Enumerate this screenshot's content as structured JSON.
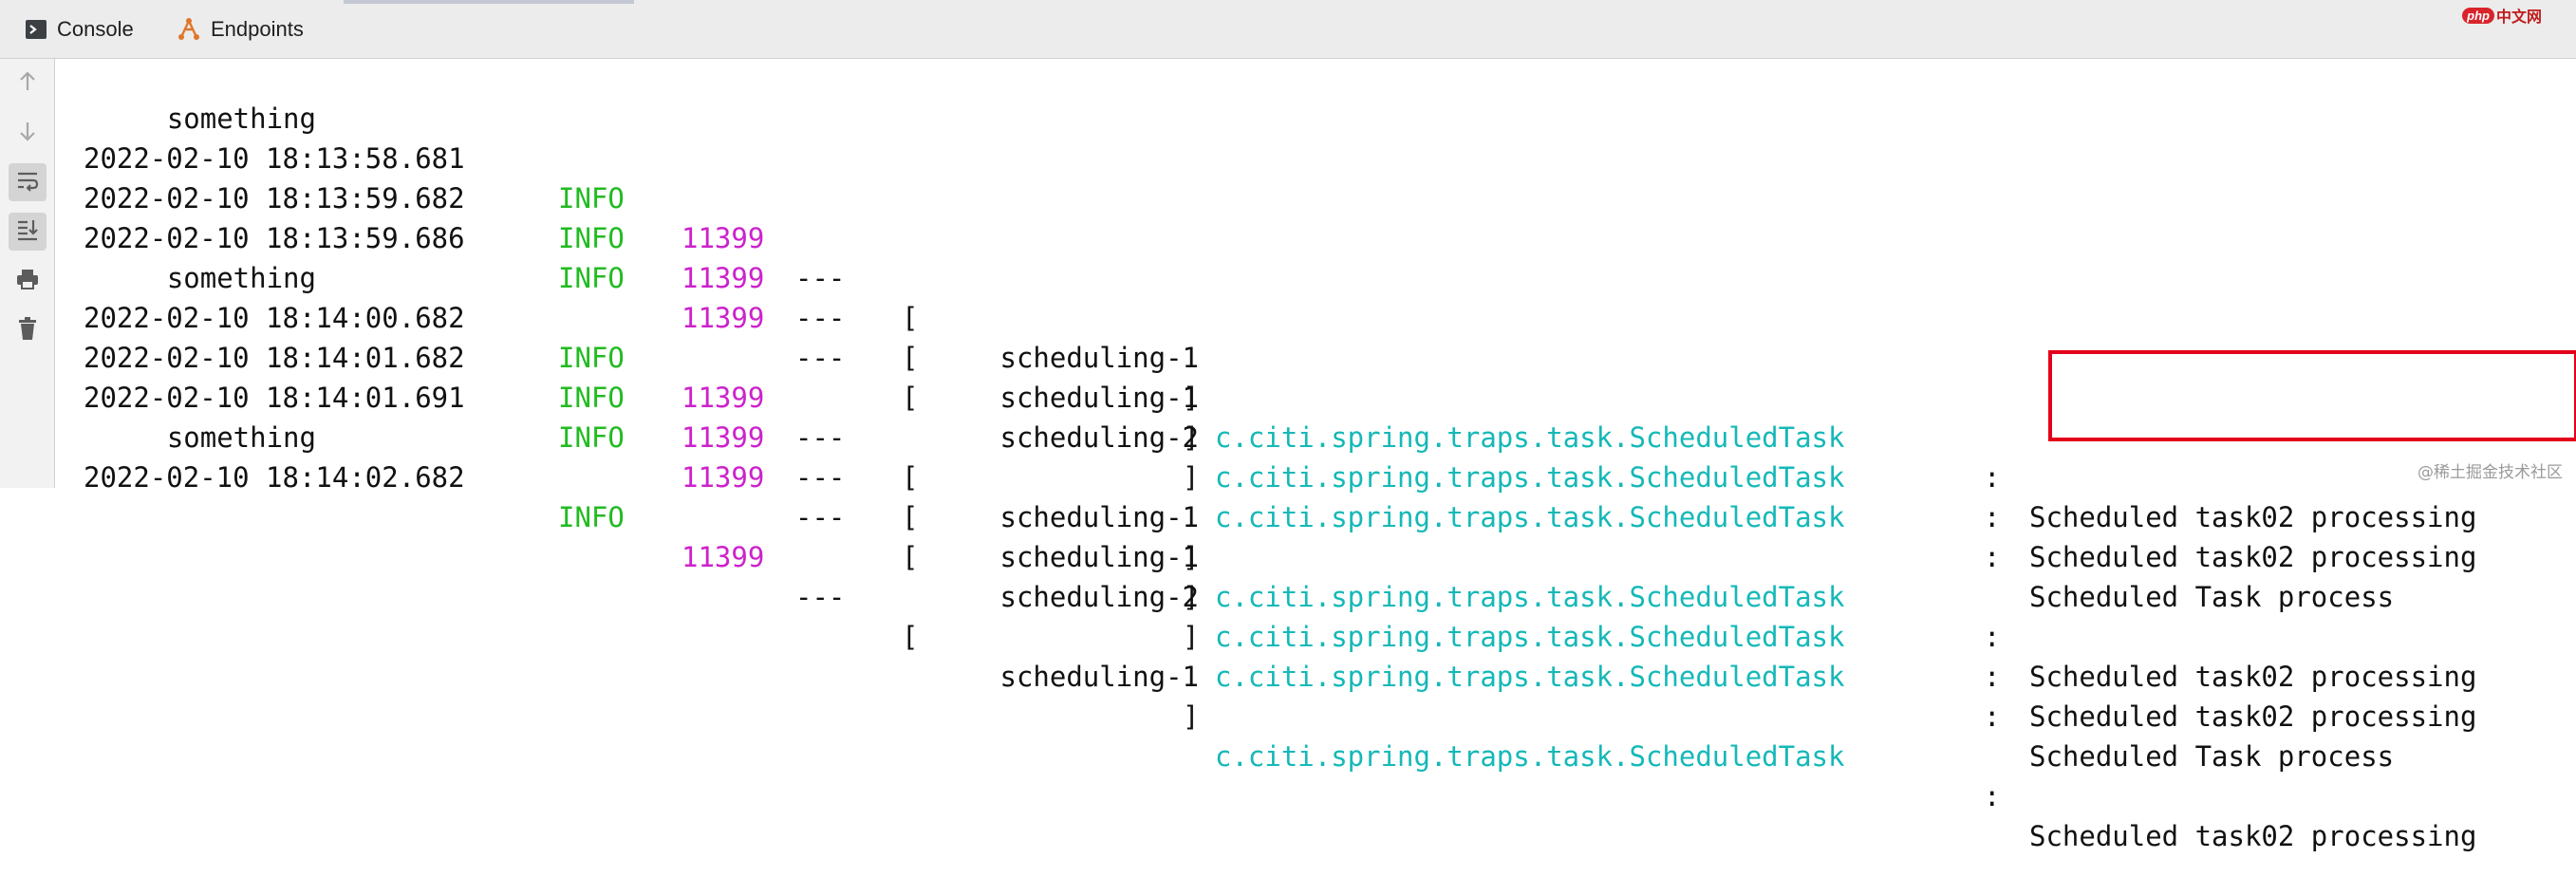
{
  "tabs": [
    {
      "label": "Console",
      "icon": "console-icon",
      "active": true
    },
    {
      "label": "Endpoints",
      "icon": "endpoints-icon",
      "active": false
    }
  ],
  "toolbar": {
    "buttons": [
      "up-arrow-icon",
      "down-arrow-icon",
      "soft-wrap-icon",
      "scroll-to-end-icon",
      "print-icon",
      "trash-icon"
    ]
  },
  "console": {
    "lines": [
      {
        "kind": "cont",
        "text": "something"
      },
      {
        "kind": "log",
        "timestamp": "2022-02-10 18:13:58.681",
        "level": "INFO",
        "pid": "11399",
        "sep": "---",
        "lbracket": "[",
        "thread": "scheduling-1",
        "rbracket": "]",
        "logger": "c.citi.spring.traps.task.ScheduledTask",
        "colon": ":",
        "message": "Scheduled task02 processing"
      },
      {
        "kind": "log",
        "timestamp": "2022-02-10 18:13:59.682",
        "level": "INFO",
        "pid": "11399",
        "sep": "---",
        "lbracket": "[",
        "thread": "scheduling-1",
        "rbracket": "]",
        "logger": "c.citi.spring.traps.task.ScheduledTask",
        "colon": ":",
        "message": "Scheduled task02 processing"
      },
      {
        "kind": "log",
        "timestamp": "2022-02-10 18:13:59.686",
        "level": "INFO",
        "pid": "11399",
        "sep": "---",
        "lbracket": "[",
        "thread": "scheduling-2",
        "rbracket": "]",
        "logger": "c.citi.spring.traps.task.ScheduledTask",
        "colon": ":",
        "message": "Scheduled Task process"
      },
      {
        "kind": "cont",
        "text": "something"
      },
      {
        "kind": "log",
        "timestamp": "2022-02-10 18:14:00.682",
        "level": "INFO",
        "pid": "11399",
        "sep": "---",
        "lbracket": "[",
        "thread": "scheduling-1",
        "rbracket": "]",
        "logger": "c.citi.spring.traps.task.ScheduledTask",
        "colon": ":",
        "message": "Scheduled task02 processing"
      },
      {
        "kind": "log",
        "timestamp": "2022-02-10 18:14:01.682",
        "level": "INFO",
        "pid": "11399",
        "sep": "---",
        "lbracket": "[",
        "thread": "scheduling-1",
        "rbracket": "]",
        "logger": "c.citi.spring.traps.task.ScheduledTask",
        "colon": ":",
        "message": "Scheduled task02 processing"
      },
      {
        "kind": "log",
        "timestamp": "2022-02-10 18:14:01.691",
        "level": "INFO",
        "pid": "11399",
        "sep": "---",
        "lbracket": "[",
        "thread": "scheduling-2",
        "rbracket": "]",
        "logger": "c.citi.spring.traps.task.ScheduledTask",
        "colon": ":",
        "message": "Scheduled Task process"
      },
      {
        "kind": "cont",
        "text": "something"
      },
      {
        "kind": "log",
        "timestamp": "2022-02-10 18:14:02.682",
        "level": "INFO",
        "pid": "11399",
        "sep": "---",
        "lbracket": "[",
        "thread": "scheduling-1",
        "rbracket": "]",
        "logger": "c.citi.spring.traps.task.ScheduledTask",
        "colon": ":",
        "message": "Scheduled task02 processing"
      }
    ]
  },
  "colors": {
    "level": "#22bb22",
    "pid": "#cc22cc",
    "logger": "#16b8b8",
    "highlight": "#e4001b"
  },
  "watermarks": {
    "top_badge": "php",
    "top_text": "中文网",
    "bottom": "@稀土掘金技术社区"
  }
}
